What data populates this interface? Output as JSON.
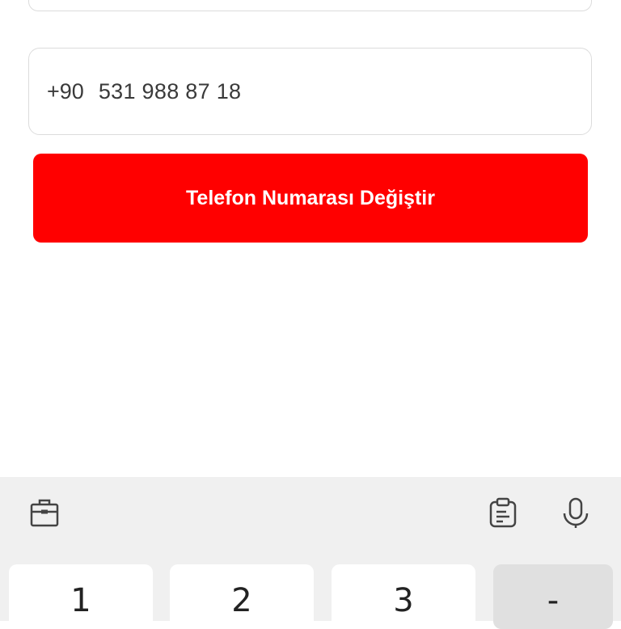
{
  "form": {
    "phone_prefix": "+90",
    "phone_number": "531 988 87 18",
    "submit_label": "Telefon Numarası Değiştir"
  },
  "keyboard": {
    "toolbar_icons": [
      "briefcase-icon",
      "clipboard-icon",
      "microphone-icon"
    ],
    "keys": [
      "1",
      "2",
      "3",
      "-"
    ]
  },
  "colors": {
    "accent": "#ff0000",
    "keyboard_bg": "#f0f0f0"
  }
}
